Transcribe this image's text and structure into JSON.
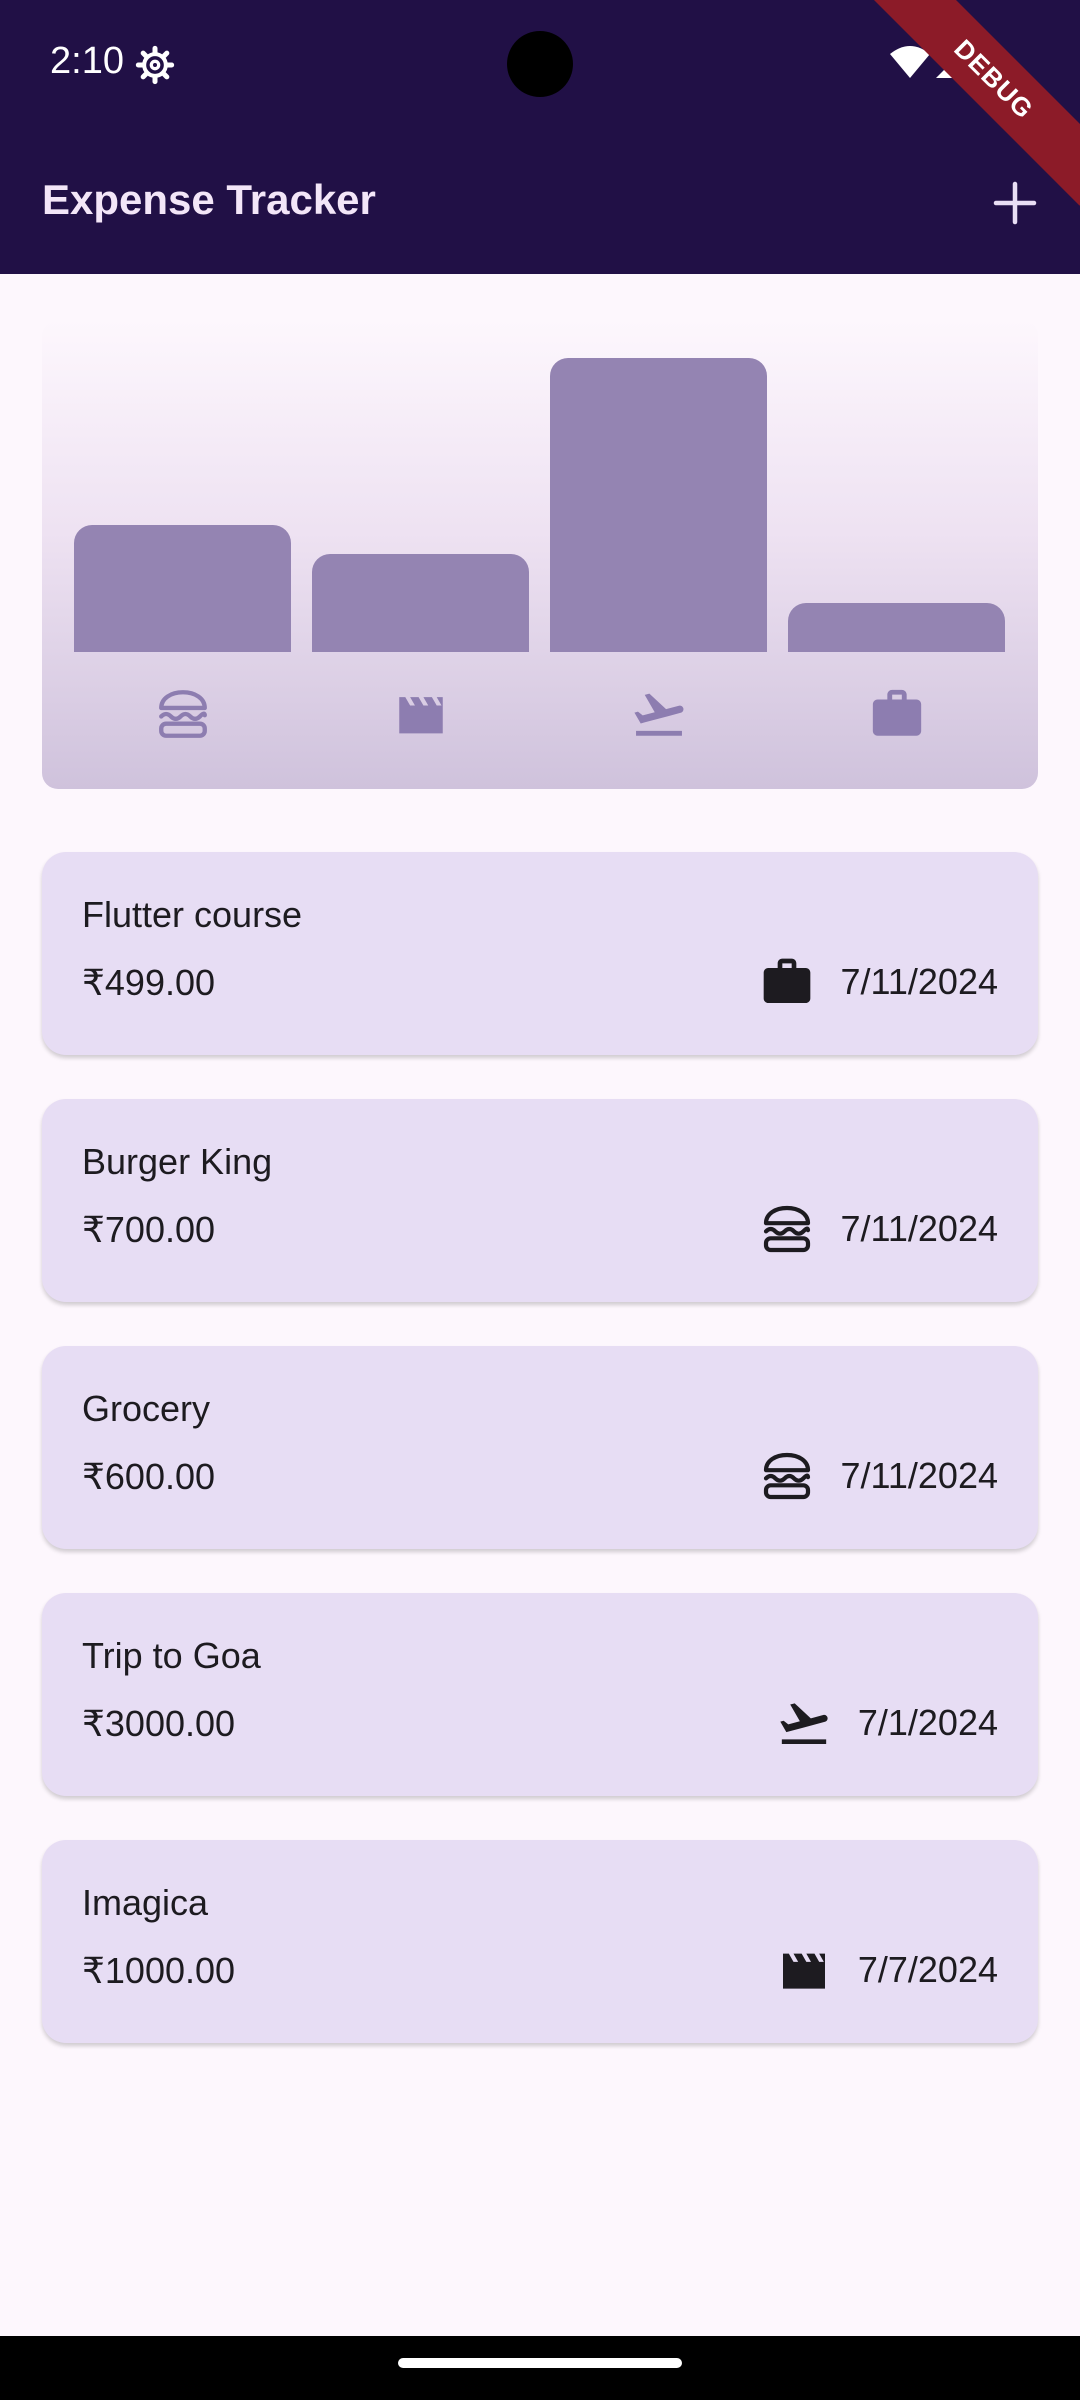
{
  "status_bar": {
    "time": "2:10",
    "debug_label": "DEBUG"
  },
  "app_bar": {
    "title": "Expense Tracker",
    "add_icon": "plus-icon"
  },
  "chart_data": {
    "type": "bar",
    "categories": [
      "food",
      "leisure",
      "travel",
      "work"
    ],
    "category_icons": [
      "burger-icon",
      "clapperboard-icon",
      "flight-takeoff-icon",
      "briefcase-icon"
    ],
    "values": [
      1300,
      1000,
      3000,
      499
    ],
    "bar_color": "#9484b2"
  },
  "expenses": [
    {
      "title": "Flutter course",
      "amount": "₹499.00",
      "category_icon": "briefcase-icon",
      "date": "7/11/2024"
    },
    {
      "title": "Burger King",
      "amount": "₹700.00",
      "category_icon": "burger-icon",
      "date": "7/11/2024"
    },
    {
      "title": "Grocery",
      "amount": "₹600.00",
      "category_icon": "burger-icon",
      "date": "7/11/2024"
    },
    {
      "title": "Trip to Goa",
      "amount": "₹3000.00",
      "category_icon": "flight-takeoff-icon",
      "date": "7/1/2024"
    },
    {
      "title": "Imagica",
      "amount": "₹1000.00",
      "category_icon": "clapperboard-icon",
      "date": "7/7/2024"
    }
  ],
  "colors": {
    "app_bar": "#211046",
    "card": "#e7ddf4",
    "background": "#fdf7fd",
    "text": "#1d1b20"
  }
}
